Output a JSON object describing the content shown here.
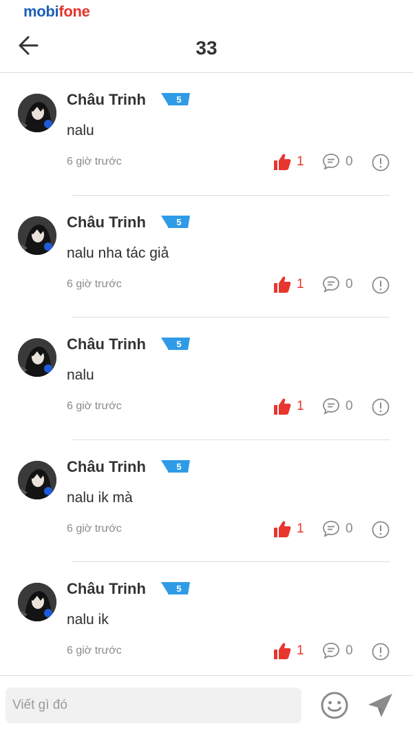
{
  "status_bar": {
    "brand_part1": "mobi",
    "brand_part2": "fone"
  },
  "header": {
    "title": "33"
  },
  "comments": [
    {
      "name": "Châu Trinh",
      "badge": "5",
      "text": "nalu",
      "time": "6 giờ trước",
      "likes": "1",
      "replies": "0"
    },
    {
      "name": "Châu Trinh",
      "badge": "5",
      "text": "nalu nha tác giả",
      "time": "6 giờ trước",
      "likes": "1",
      "replies": "0"
    },
    {
      "name": "Châu Trinh",
      "badge": "5",
      "text": "nalu",
      "time": "6 giờ trước",
      "likes": "1",
      "replies": "0"
    },
    {
      "name": "Châu Trinh",
      "badge": "5",
      "text": "nalu ik mà",
      "time": "6 giờ trước",
      "likes": "1",
      "replies": "0"
    },
    {
      "name": "Châu Trinh",
      "badge": "5",
      "text": "nalu ik",
      "time": "6 giờ trước",
      "likes": "1",
      "replies": "0"
    }
  ],
  "composer": {
    "placeholder": "Viết gì đó"
  },
  "colors": {
    "like": "#e8352e",
    "brand_blue": "#1d5fb6",
    "brand_red": "#e4322b",
    "badge": "#2f9be6"
  }
}
